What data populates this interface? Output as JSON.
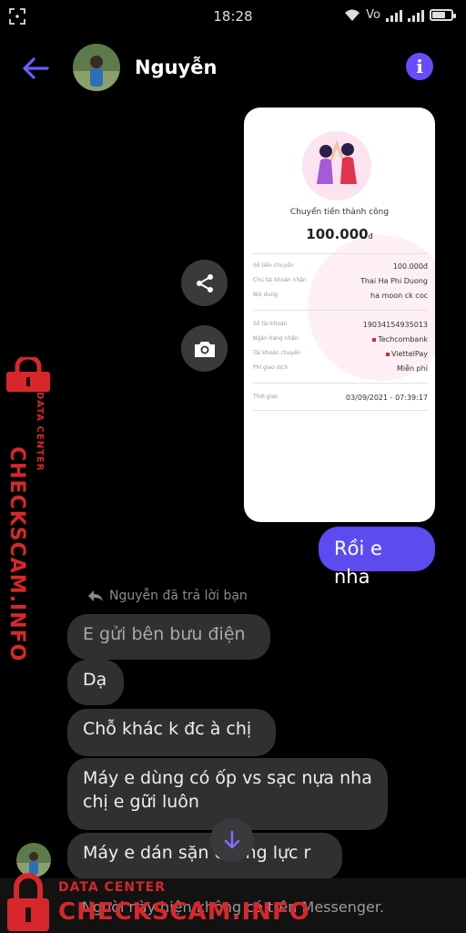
{
  "status_bar": {
    "time": "18:28",
    "network": "Vo",
    "battery_level": 0.7
  },
  "header": {
    "contact_name": "Nguyễn"
  },
  "receipt": {
    "title": "Chuyển tiền thành công",
    "amount": "100.000",
    "currency": "đ",
    "rows": [
      {
        "key": "Số tiền chuyển",
        "value": "100.000đ"
      },
      {
        "key": "Chủ tài khoản nhận",
        "value": "Thai Ha Phi Duong"
      },
      {
        "key": "Nội dung",
        "value": "ha moon ck coc"
      },
      {
        "key": "Số tài khoản",
        "value": "19034154935013"
      },
      {
        "key": "Ngân hàng nhận",
        "value": "Techcombank"
      },
      {
        "key": "Tài khoản chuyển",
        "value": "ViettelPay"
      },
      {
        "key": "Phí giao dịch",
        "value": "Miễn phí"
      },
      {
        "key": "Thời gian",
        "value": "03/09/2021 - 07:39:17"
      }
    ]
  },
  "messages": {
    "outgoing": [
      "Rồi e nha"
    ],
    "reply_note": "Nguyễn đã trả lời bạn",
    "incoming": [
      "E gửi bên bưu điện",
      "Dạ",
      "Chỗ khác k đc à chị",
      "Máy e dùng có ốp vs sạc nựa nha chị e gữi luôn",
      "Máy e dán sặn cường lực r"
    ]
  },
  "notice": "Người này hiện không có trên Messenger.",
  "watermark": {
    "brand": "CHECKSCAM.INFO",
    "subtitle": "DATA CENTER",
    "color": "#d8272b"
  },
  "colors": {
    "accent": "#5b4bf0",
    "info": "#6a4cff",
    "incoming_bubble": "#303030"
  }
}
